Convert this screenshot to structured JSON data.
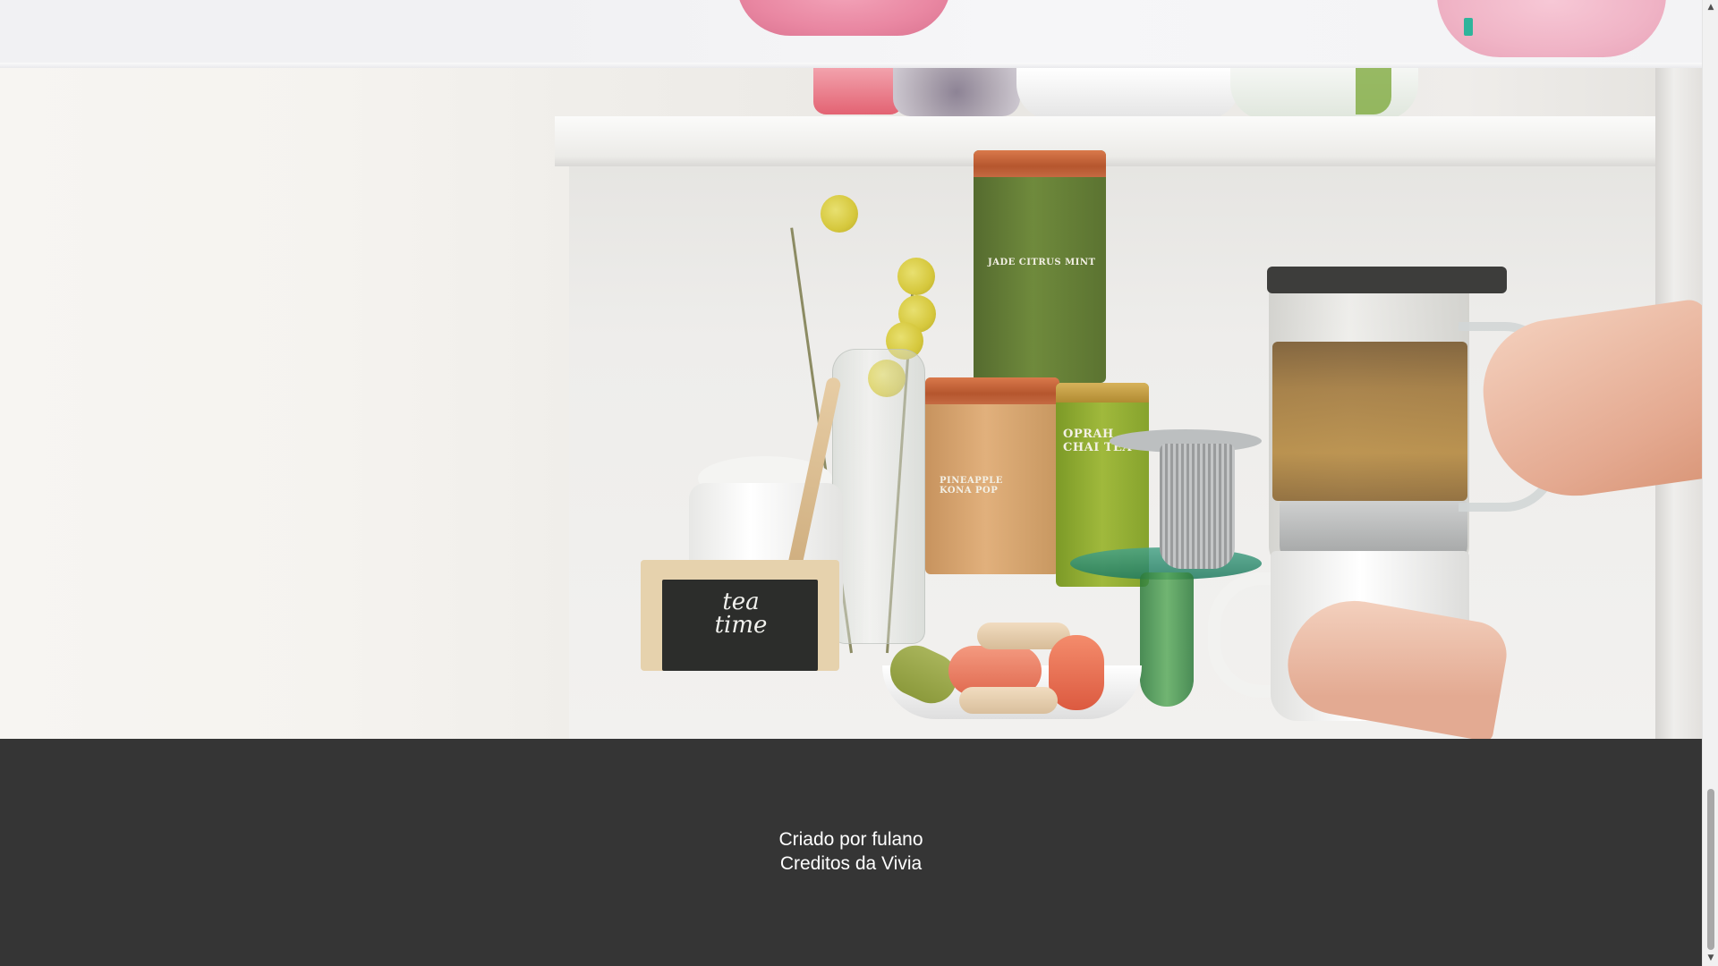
{
  "hero": {
    "image_alt": "tea time",
    "chalkboard_text_line1": "tea",
    "chalkboard_text_line2": "time",
    "tins": [
      {
        "name": "JADE CITRUS MINT"
      },
      {
        "name": "PINEAPPLE KONA POP"
      },
      {
        "name": "OPRAH CHAI TEA"
      }
    ]
  },
  "footer": {
    "line1": "Criado por fulano",
    "line2": "Creditos da Vivia",
    "background": "#353535",
    "text_color": "#ffffff"
  },
  "scrollbar": {
    "up_icon": "▲",
    "down_icon": "▼"
  }
}
